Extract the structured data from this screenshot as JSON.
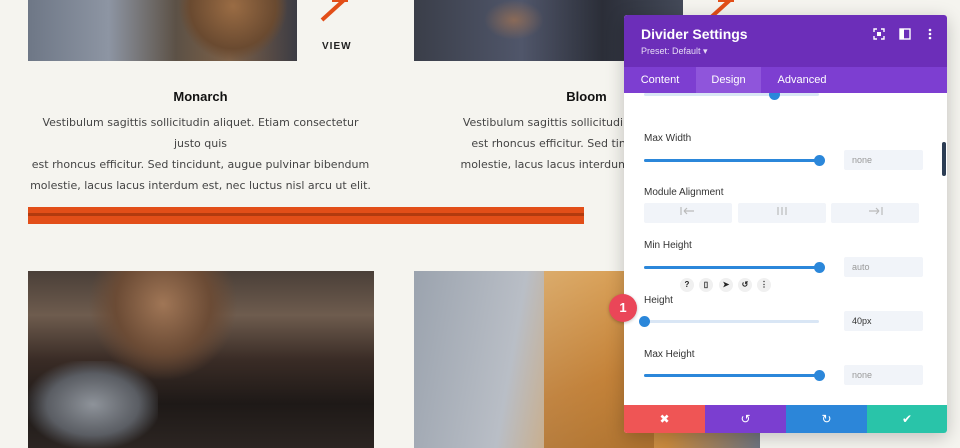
{
  "cards": [
    {
      "title": "Monarch",
      "text_lines": [
        "Vestibulum sagittis sollicitudin aliquet. Etiam consectetur justo quis",
        "est rhoncus efficitur. Sed tincidunt, augue pulvinar bibendum",
        "molestie, lacus lacus interdum est, nec luctus nisl arcu ut elit."
      ],
      "link_label": "VIEW"
    },
    {
      "title": "Bloom",
      "text_lines": [
        "Vestibulum sagittis sollicitudin aliquet. Etiam",
        "est rhoncus efficitur. Sed tincidunt, augue",
        "molestie, lacus lacus interdum est, nec luctus"
      ]
    }
  ],
  "colors": {
    "accent_orange": "#e24e18",
    "panel_purple": "#6c2eb9",
    "slider_blue": "#2b87da",
    "cancel_red": "#ef5555",
    "save_teal": "#29c4a9",
    "badge_red": "#ea4658"
  },
  "panel": {
    "title": "Divider Settings",
    "preset": "Preset: Default ▾",
    "header_icons": [
      "expand-icon",
      "split-view-icon",
      "more-vertical-icon"
    ],
    "tabs": [
      {
        "label": "Content",
        "active": false
      },
      {
        "label": "Design",
        "active": true
      },
      {
        "label": "Advanced",
        "active": false
      }
    ],
    "fields": {
      "max_width": {
        "label": "Max Width",
        "value": "none",
        "level": 1.0
      },
      "module_alignment": {
        "label": "Module Alignment",
        "options": [
          "left-align-icon",
          "center-align-icon",
          "right-align-icon"
        ]
      },
      "min_height": {
        "label": "Min Height",
        "value": "auto",
        "level": 1.0
      },
      "height": {
        "label": "Height",
        "value": "40px",
        "level": 0.0,
        "icons": [
          "?",
          "▯",
          "➤",
          "↺",
          "⋮"
        ]
      },
      "max_height": {
        "label": "Max Height",
        "value": "none",
        "level": 1.0
      }
    },
    "footer": {
      "cancel": "✖",
      "undo": "↺",
      "redo": "↻",
      "save": "✔"
    }
  },
  "step_badge": "1"
}
